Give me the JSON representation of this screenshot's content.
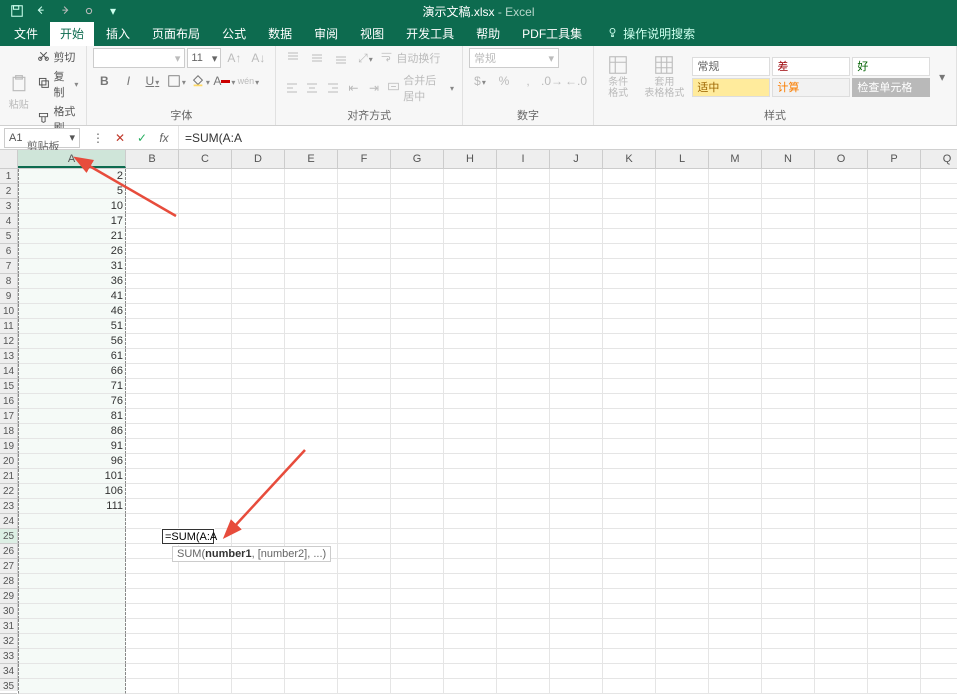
{
  "title": {
    "doc": "演示文稿.xlsx",
    "sep": " - ",
    "app": "Excel"
  },
  "tabs": {
    "file": "文件",
    "home": "开始",
    "insert": "插入",
    "layout": "页面布局",
    "formulas": "公式",
    "data": "数据",
    "review": "审阅",
    "view": "视图",
    "dev": "开发工具",
    "help": "帮助",
    "pdf": "PDF工具集",
    "tellme": "操作说明搜索"
  },
  "clipboard": {
    "paste": "粘贴",
    "cut": "剪切",
    "copy": "复制",
    "brush": "格式刷",
    "group": "剪贴板"
  },
  "font": {
    "name": "",
    "size": "11",
    "group": "字体"
  },
  "align": {
    "wrap": "自动换行",
    "merge": "合并后居中",
    "group": "对齐方式"
  },
  "number": {
    "format": "常规",
    "group": "数字"
  },
  "styles": {
    "cond": "条件格式",
    "table": "套用\n表格格式",
    "group": "样式",
    "normal": "常规",
    "bad": "差",
    "good": "好",
    "neutral": "适中",
    "calc": "计算",
    "check": "检查单元格"
  },
  "namebox": "A1",
  "formula": "=SUM(A:A",
  "edit_cell": "=SUM(A:A",
  "tooltip": {
    "fn": "SUM",
    "arg1": "number1",
    "rest": ", [number2], ...)"
  },
  "cols": [
    "A",
    "B",
    "C",
    "D",
    "E",
    "F",
    "G",
    "H",
    "I",
    "J",
    "K",
    "L",
    "M",
    "N",
    "O",
    "P",
    "Q"
  ],
  "row_count": 35,
  "col_a_values": [
    2,
    5,
    10,
    17,
    21,
    26,
    31,
    36,
    41,
    46,
    51,
    56,
    61,
    66,
    71,
    76,
    81,
    86,
    91,
    96,
    101,
    106,
    111
  ],
  "chart_data": null
}
